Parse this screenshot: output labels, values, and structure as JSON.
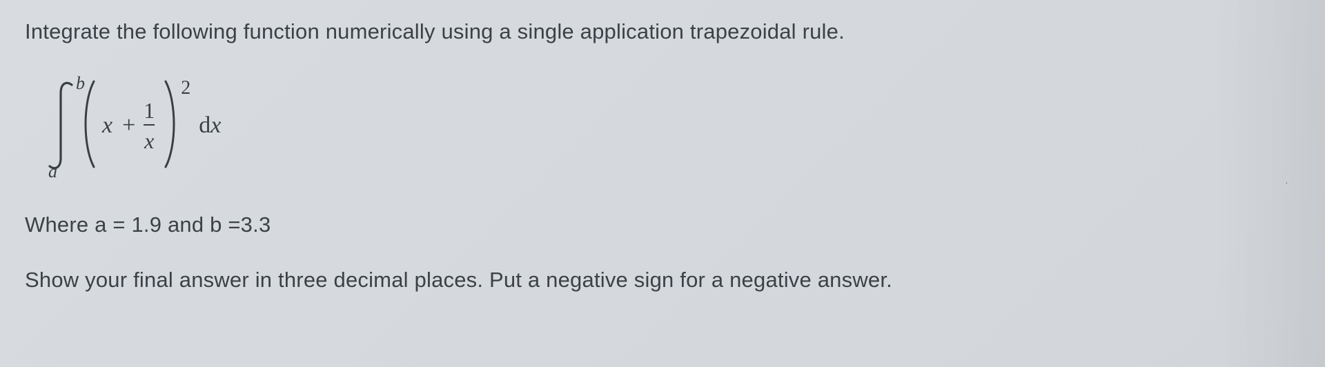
{
  "problem": {
    "statement": "Integrate the following function numerically using a single application trapezoidal rule.",
    "integral": {
      "lower_limit": "a",
      "upper_limit": "b",
      "term_left": "x",
      "operator": "+",
      "fraction_num": "1",
      "fraction_den": "x",
      "exponent": "2",
      "differential_d": "d",
      "differential_var": "x"
    },
    "where": "Where a = 1.9 and b =3.3",
    "instruction": "Show your final answer in three decimal places. Put a negative sign for a negative answer."
  }
}
